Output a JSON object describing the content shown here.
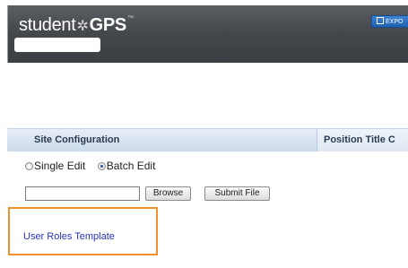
{
  "header": {
    "logo_prefix": "student",
    "logo_suffix": "GPS",
    "logo_mark": "™",
    "export_label": "EXPO"
  },
  "tabs": [
    {
      "label": "Site Configuration"
    },
    {
      "label": "Position Title C"
    }
  ],
  "edit_mode": {
    "options": [
      {
        "label": "Single Edit",
        "checked": false
      },
      {
        "label": "Batch Edit",
        "checked": true
      }
    ]
  },
  "file_upload": {
    "browse_label": "Browse",
    "submit_label": "Submit File"
  },
  "template": {
    "link_label": "User Roles Template"
  },
  "colors": {
    "header_bg": "#45484c",
    "tab_bg": "#cbd9ea",
    "highlight_border": "#f0902c",
    "link": "#2433b8",
    "export_button": "#1f5fae"
  }
}
